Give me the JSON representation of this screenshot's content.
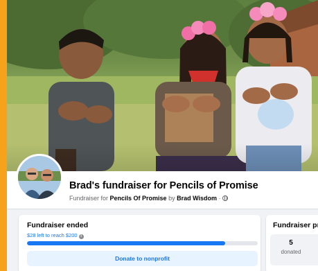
{
  "fundraiser": {
    "title": "Brad's fundraiser for Pencils of Promise",
    "subtitle_prefix": "Fundraiser for ",
    "nonprofit": "Pencils Of Promise",
    "by_text": " by ",
    "organizer": "Brad Wisdom",
    "separator": " · "
  },
  "status_card": {
    "title": "Fundraiser ended",
    "remaining_text": "$28 left to reach $200",
    "progress_fraction": 0.86,
    "donate_label": "Donate to nonprofit"
  },
  "progress_card": {
    "title": "Fundraiser prog",
    "donated_count": "5",
    "donated_label": "donated"
  },
  "colors": {
    "accent": "#1877f2",
    "button_bg": "#e7f3ff",
    "page_bg": "#f0f2f5",
    "border_orange": "#f7a21b"
  },
  "icons": {
    "info": "info-icon",
    "audience": "globe-icon"
  }
}
